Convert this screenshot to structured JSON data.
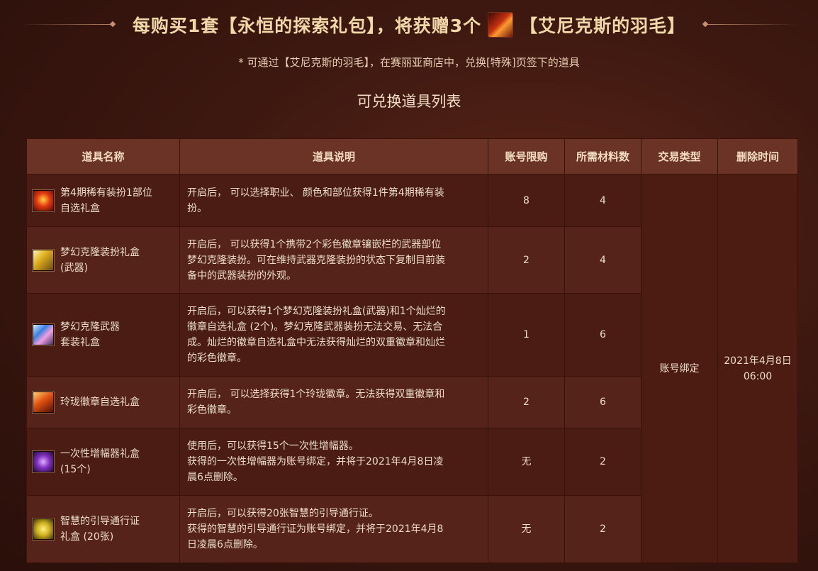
{
  "banner": {
    "title_before": "每购买1套【永恒的探索礼包】，将获赠3个",
    "title_after": "【艾尼克斯的羽毛】"
  },
  "subtitle": "* 可通过【艾尼克斯的羽毛】，在赛丽亚商店中，兑换[特殊]页签下的道具",
  "section_title": "可兑换道具列表",
  "table": {
    "headers": [
      "道具名称",
      "道具说明",
      "账号限购",
      "所需材料数",
      "交易类型",
      "删除时间"
    ],
    "trade_type": "账号绑定",
    "delete_time_line1": "2021年4月8日",
    "delete_time_line2": "06:00",
    "rows": [
      {
        "icon": "costume-box-icon",
        "name_line1": "第4期稀有装扮1部位",
        "name_line2": "自选礼盒",
        "desc_line1": "开启后， 可以选择职业、 颜色和部位获得1件第4期稀有装",
        "desc_line2": "扮。",
        "desc_line3": "",
        "desc_line4": "",
        "limit": "8",
        "cost": "4"
      },
      {
        "icon": "weapon-clone-icon",
        "name_line1": "梦幻克隆装扮礼盒",
        "name_line2": "(武器)",
        "desc_line1": "开启后， 可以获得1个携带2个彩色徽章镶嵌栏的武器部位",
        "desc_line2": "梦幻克隆装扮。可在维持武器克隆装扮的状态下复制目前装",
        "desc_line3": "备中的武器装扮的外观。",
        "desc_line4": "",
        "limit": "2",
        "cost": "4"
      },
      {
        "icon": "weapon-set-icon",
        "name_line1": "梦幻克隆武器",
        "name_line2": "套装礼盒",
        "desc_line1": "开启后，可以获得1个梦幻克隆装扮礼盒(武器)和1个灿烂的",
        "desc_line2": "徽章自选礼盒 (2个)。梦幻克隆武器装扮无法交易、无法合",
        "desc_line3": "成。灿烂的徽章自选礼盒中无法获得灿烂的双重徽章和灿烂",
        "desc_line4": "的彩色徽章。",
        "limit": "1",
        "cost": "6"
      },
      {
        "icon": "emblem-box-icon",
        "name_line1": "玲珑徽章自选礼盒",
        "name_line2": "",
        "desc_line1": "开启后， 可以选择获得1个玲珑徽章。无法获得双重徽章和",
        "desc_line2": "彩色徽章。",
        "desc_line3": "",
        "desc_line4": "",
        "limit": "2",
        "cost": "6"
      },
      {
        "icon": "amplifier-box-icon",
        "name_line1": "一次性增幅器礼盒",
        "name_line2": "(15个)",
        "desc_line1": "使用后，可以获得15个一次性增幅器。",
        "desc_line2": "获得的一次性增幅器为账号绑定，并将于2021年4月8日凌",
        "desc_line3": "晨6点删除。",
        "desc_line4": "",
        "limit": "无",
        "cost": "2"
      },
      {
        "icon": "guide-pass-icon",
        "name_line1": "智慧的引导通行证",
        "name_line2": "礼盒 (20张)",
        "desc_line1": "开启后，可以获得20张智慧的引导通行证。",
        "desc_line2": "获得的智慧的引导通行证为账号绑定，并将于2021年4月8",
        "desc_line3": "日凌晨6点删除。",
        "desc_line4": "",
        "limit": "无",
        "cost": "2"
      }
    ]
  }
}
